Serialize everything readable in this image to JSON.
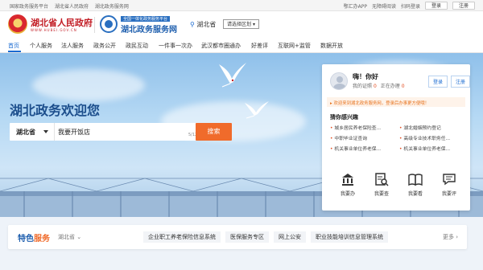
{
  "topbar": {
    "left": [
      "国家政务服务平台",
      "湖北省人民政府",
      "湖北政务服务网"
    ],
    "links": [
      "鄂汇办APP",
      "无障碍阅读",
      "扫码登录"
    ],
    "login": "登录",
    "register": "注册"
  },
  "header": {
    "gov_name": "湖北省人民政府",
    "gov_sub": "WWW.HUBEI.GOV.CN",
    "svc_tag": "全国一体化政务服务平台",
    "svc_name": "湖北政务服务网",
    "svc_sub": "ZWFW.HUBEI.GOV.CN",
    "location": "湖北省",
    "region_button": "请选择区划"
  },
  "nav": {
    "items": [
      "首页",
      "个人服务",
      "法人服务",
      "政务公开",
      "政民互动",
      "一件事一次办",
      "武汉都市圈通办",
      "好差评",
      "互联网+监管",
      "数据开放"
    ],
    "active": 0
  },
  "hero": {
    "welcome": "湖北政务欢迎您",
    "search_region": "湖北省",
    "search_value": "我要开饭店",
    "char_count": "5/128",
    "search_button": "搜索"
  },
  "panel": {
    "greeting": "嗨！你好",
    "certificates_label": "我的证照",
    "certificates_count": "0",
    "in_progress_label": "正在办理",
    "in_progress_count": "0",
    "login": "登录",
    "register": "注册",
    "notice": "欢迎来到湖北政务服务网，登录后办事更方便哦！",
    "interest_title": "猜你感兴趣",
    "services": [
      "城乡居民养老保险查...",
      "湖北婚姻预约登记",
      "中职毕业证查询",
      "高级专业技术职务任...",
      "机关事业单位养老保...",
      "机关事业单位养老保..."
    ],
    "actions": [
      {
        "label": "我要办",
        "icon": "building-icon"
      },
      {
        "label": "我要查",
        "icon": "search-doc-icon"
      },
      {
        "label": "我要看",
        "icon": "book-icon"
      },
      {
        "label": "我要评",
        "icon": "comment-icon"
      }
    ]
  },
  "feature": {
    "title_a": "特色",
    "title_b": "服务",
    "region": "湖北省",
    "tabs": [
      "企业职工养老保险信息系统",
      "医保服务专区",
      "网上公安",
      "职业技能培训信息管理系统"
    ],
    "more": "更多"
  },
  "colors": {
    "brand_blue": "#1f5fae",
    "accent_orange": "#f06b2b",
    "gov_red": "#c21c24"
  }
}
